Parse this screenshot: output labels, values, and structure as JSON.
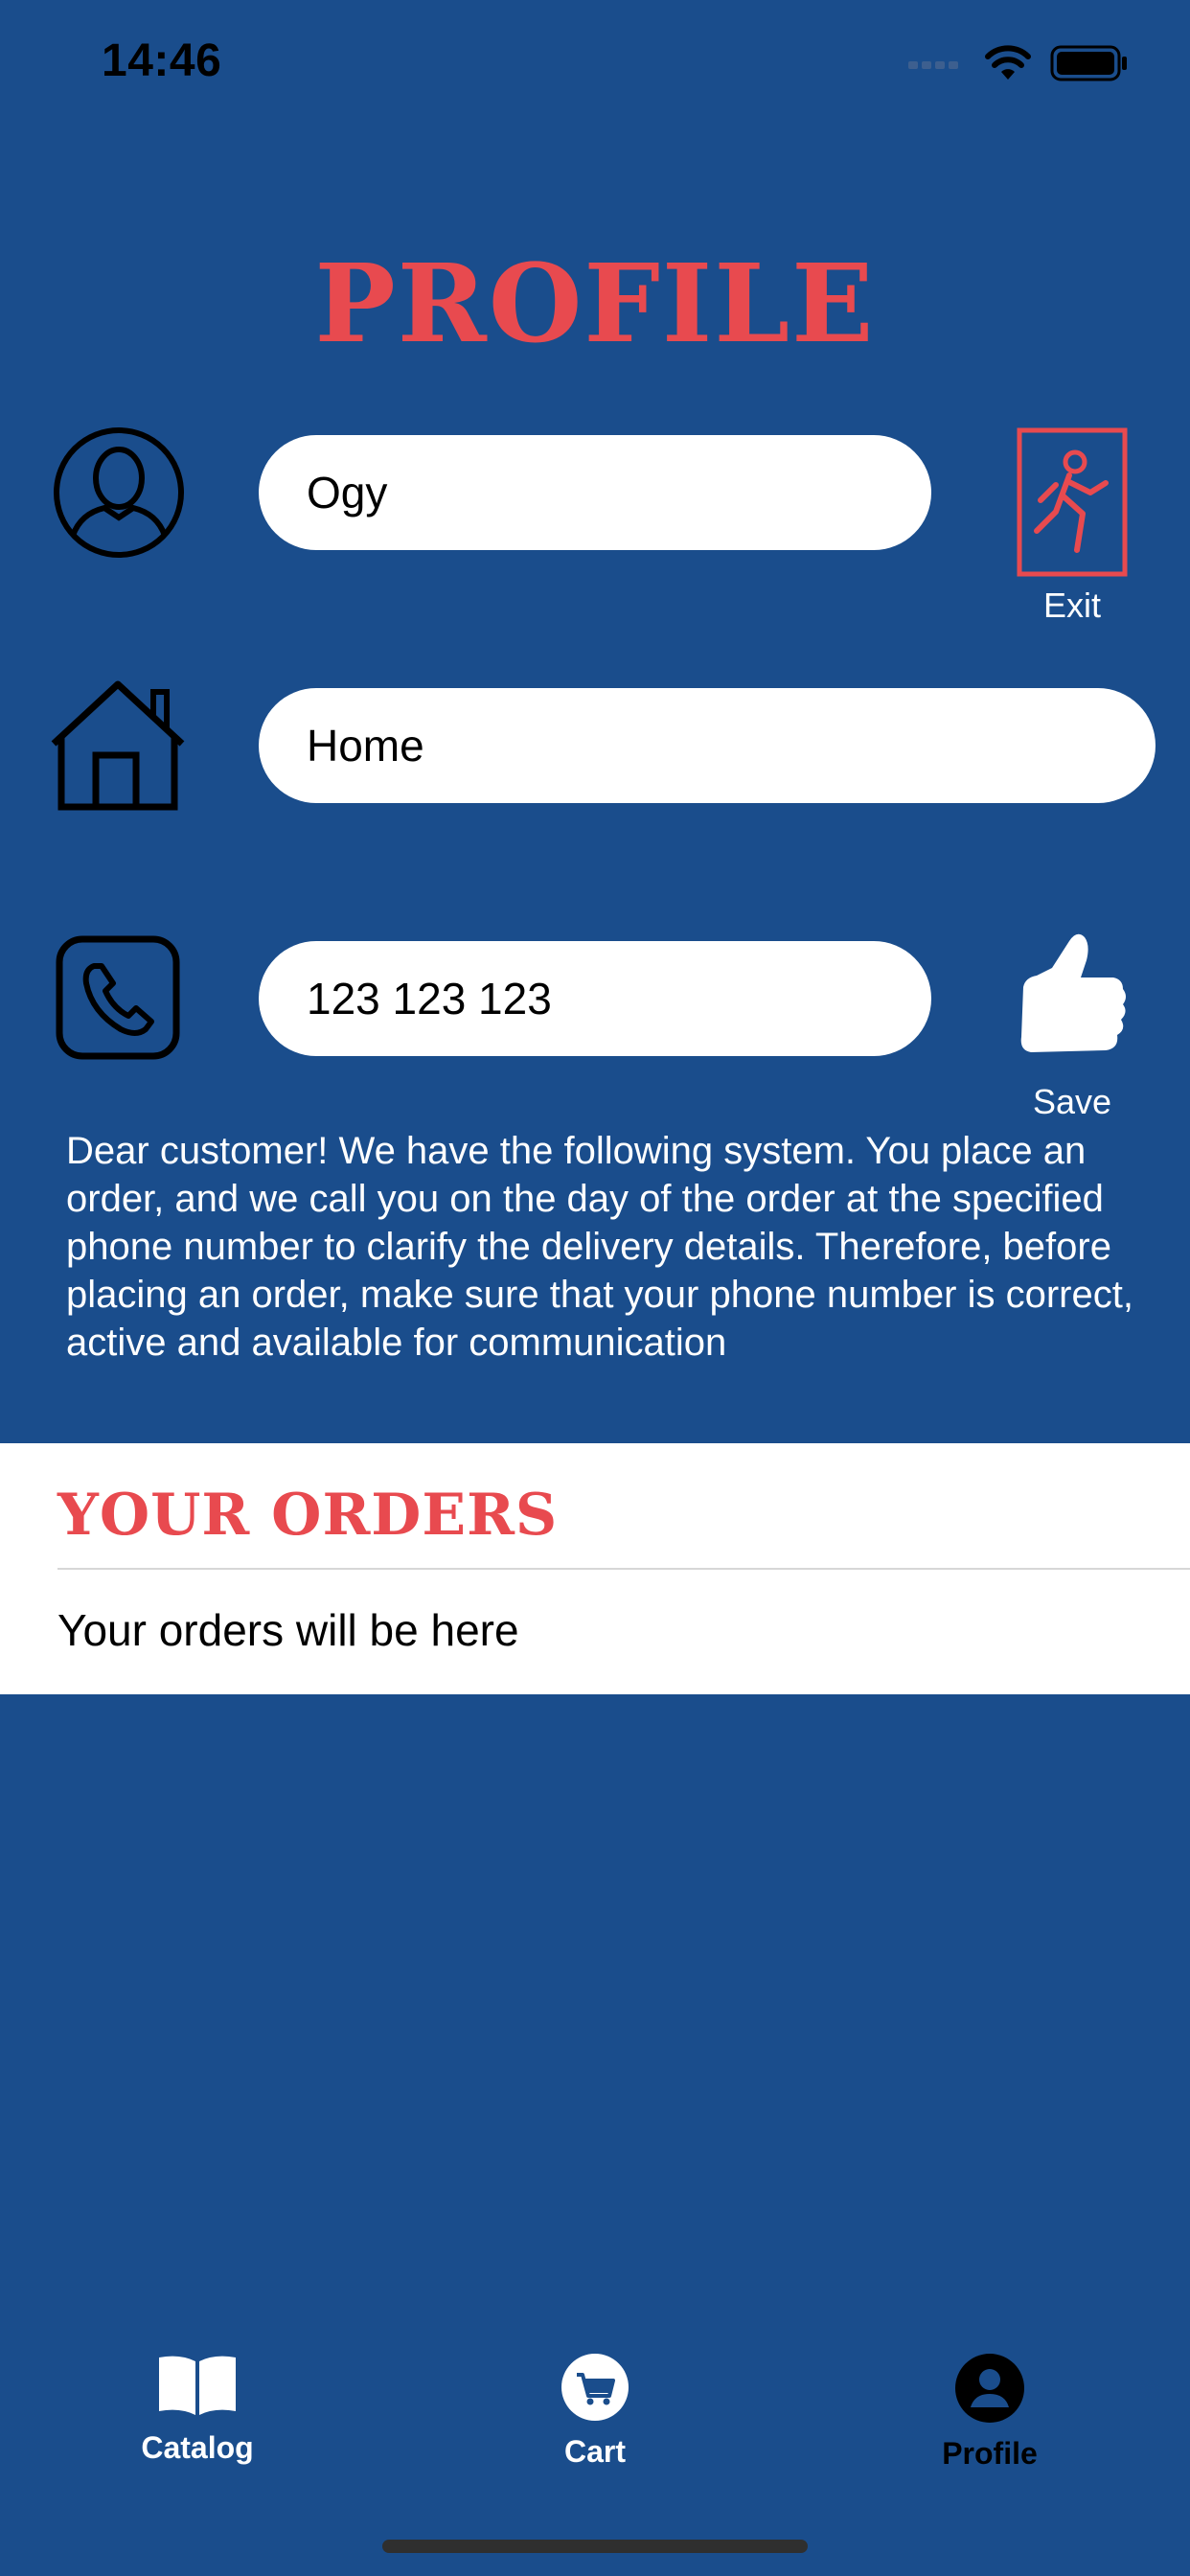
{
  "status_bar": {
    "time": "14:46"
  },
  "header": {
    "title": "PROFILE"
  },
  "form": {
    "name_value": "Ogy",
    "address_value": "Home",
    "phone_value": "123 123 123",
    "exit_label": "Exit",
    "save_label": "Save"
  },
  "notice": {
    "text": "Dear customer! We have the following system. You place an order, and we call you on the day of the order at the specified phone number to clarify the delivery details. Therefore, before placing an order, make sure that your phone number is correct, active and available for communication"
  },
  "orders": {
    "title": "YOUR ORDERS",
    "empty_text": "Your orders will be here"
  },
  "tabbar": {
    "items": [
      {
        "label": "Catalog",
        "icon": "book-icon"
      },
      {
        "label": "Cart",
        "icon": "cart-icon"
      },
      {
        "label": "Profile",
        "icon": "profile-icon",
        "active": true
      }
    ]
  },
  "colors": {
    "background": "#1A4D8C",
    "accent_red": "#E84A4F",
    "white": "#FFFFFF"
  }
}
